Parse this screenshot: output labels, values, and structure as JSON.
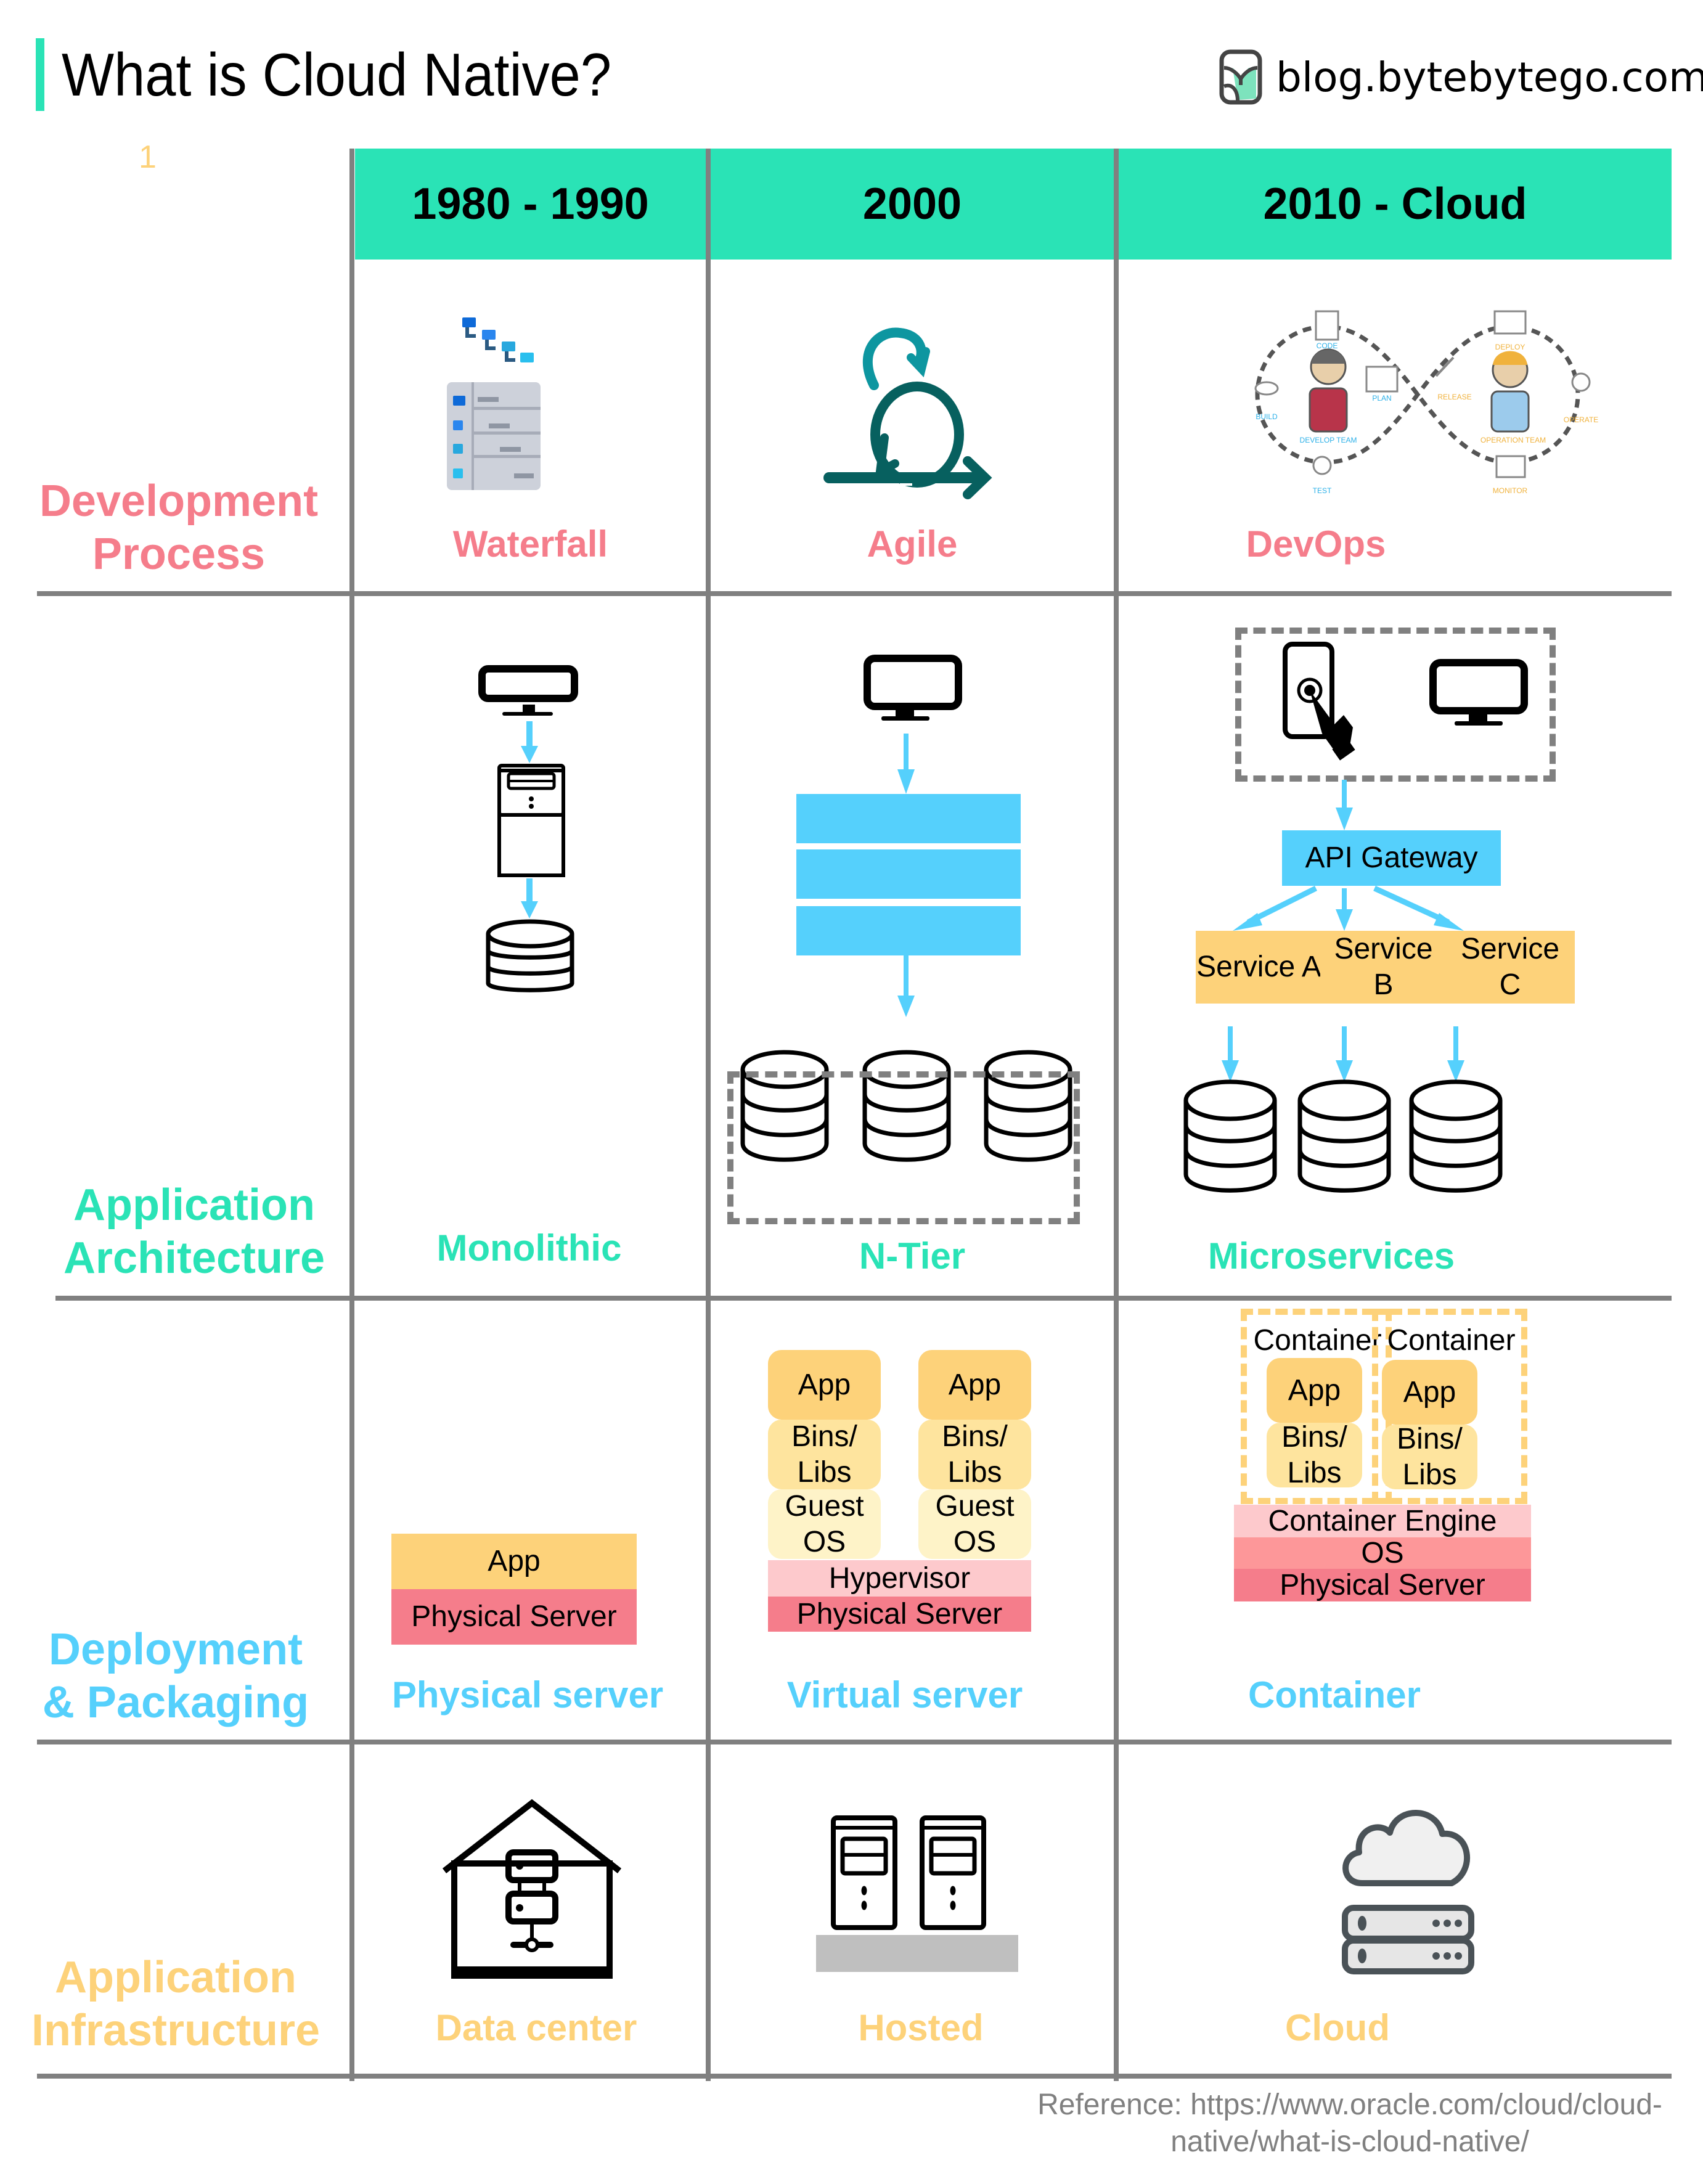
{
  "header": {
    "title": "What is Cloud Native?",
    "brand": "blog.bytebytego.com",
    "marker": "1"
  },
  "colors": {
    "accent": "#2ae3b6",
    "dev_process": "#f57d8b",
    "architecture": "#2ae3b6",
    "deployment": "#55d0fc",
    "infrastructure": "#fdd27a",
    "grid": "#808080"
  },
  "columns": [
    "1980 - 1990",
    "2000",
    "2010 - Cloud"
  ],
  "rows": {
    "development": {
      "label_line1": "Development",
      "label_line2": "Process",
      "captions": [
        "Waterfall",
        "Agile",
        "DevOps"
      ],
      "devops_steps": [
        "CODE",
        "PLAN",
        "BUILD",
        "TEST",
        "DEVELOP TEAM",
        "RELEASE",
        "DEPLOY",
        "OPERATE",
        "MONITOR",
        "OPERATION TEAM"
      ]
    },
    "architecture": {
      "label_line1": "Application",
      "label_line2": "Architecture",
      "captions": [
        "Monolithic",
        "N-Tier",
        "Microservices"
      ],
      "api_gateway": "API Gateway",
      "services": [
        {
          "line1": "Service A",
          "line2": ""
        },
        {
          "line1": "Service",
          "line2": "B"
        },
        {
          "line1": "Service",
          "line2": "C"
        }
      ]
    },
    "deployment": {
      "label_line1": "Deployment",
      "label_line2": "& Packaging",
      "captions": [
        "Physical server",
        "Virtual server",
        "Container"
      ],
      "physical": {
        "app": "App",
        "server": "Physical Server"
      },
      "virtual": {
        "app": "App",
        "bins1": "Bins/",
        "bins2": "Libs",
        "guest1": "Guest",
        "guest2": "OS",
        "hypervisor": "Hypervisor",
        "server": "Physical Server"
      },
      "container": {
        "container_label": "Container",
        "app": "App",
        "bins1": "Bins/",
        "bins2": "Libs",
        "engine": "Container Engine",
        "os": "OS",
        "server": "Physical Server"
      }
    },
    "infrastructure": {
      "label_line1": "Application",
      "label_line2": "Infrastructure",
      "captions": [
        "Data center",
        "Hosted",
        "Cloud"
      ]
    }
  },
  "reference": {
    "line1": "Reference: https://www.oracle.com/cloud/cloud-",
    "line2": "native/what-is-cloud-native/"
  }
}
